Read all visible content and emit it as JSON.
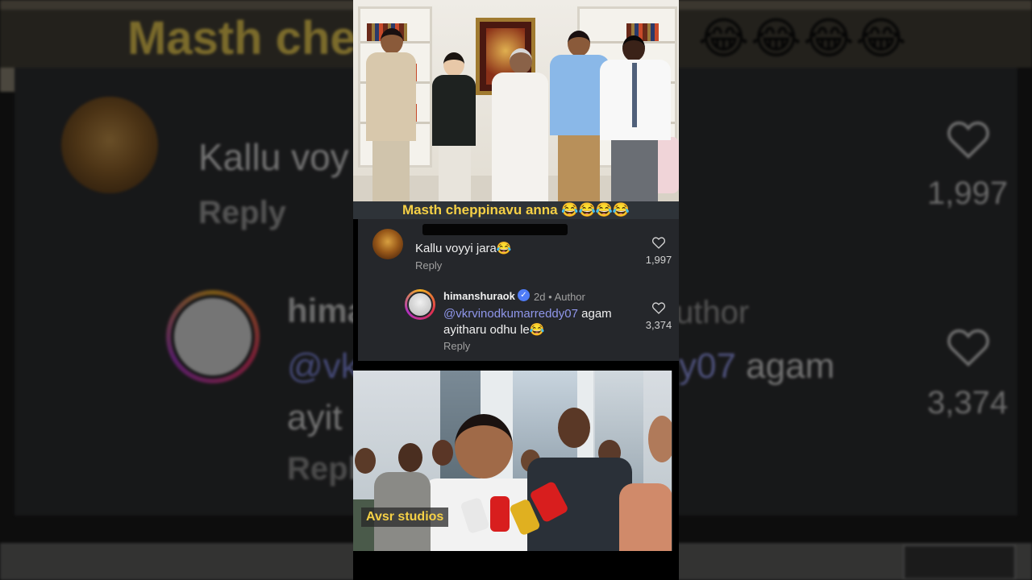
{
  "caption": {
    "text": "Masth cheppinavu anna",
    "emojis": "😂😂😂😂"
  },
  "comment1": {
    "text": "Kallu voyyi jara",
    "emoji": "😂",
    "reply_label": "Reply",
    "likes": "1,997"
  },
  "comment2": {
    "username": "himanshuraok",
    "verified": true,
    "age": "2d",
    "separator": "•",
    "role": "Author",
    "mention": "@vkrvinodkumarreddy07",
    "text_line1_rest": " agam",
    "text_line2": "ayitharu odhu le",
    "emoji": "😂",
    "reply_label": "Reply",
    "likes": "3,374"
  },
  "watermark": {
    "text": "Avsr studios"
  },
  "background": {
    "caption_fragment": "Masth che",
    "comment_fragment": "Kallu voy",
    "reply_fragment": "Reply",
    "username_fragment": "hima",
    "author_fragment": "uthor",
    "mention_fragment": "@vk",
    "mention_tail": "y07 agam",
    "line2_fragment": "ayit",
    "reply2_fragment": "Repl",
    "likes1": "1,997",
    "likes2": "3,374"
  },
  "colors": {
    "caption_yellow": "#f5d046",
    "mention_blue": "#8f96ea",
    "verified_blue": "#4f7cf7",
    "comment_bg": "#25272b"
  },
  "icons": {
    "like": "heart-icon",
    "verified": "verified-badge-icon"
  }
}
